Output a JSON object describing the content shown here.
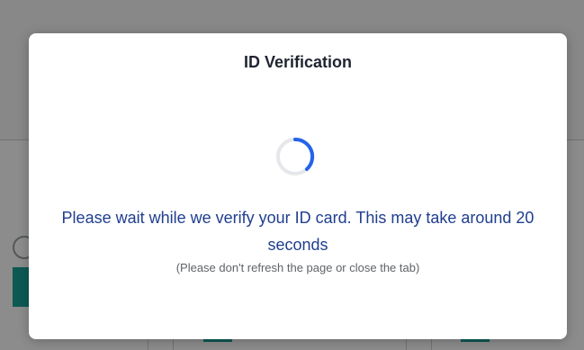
{
  "modal": {
    "title": "ID Verification",
    "message": "Please wait while we verify your ID card. This may take around 20 seconds",
    "hint": "(Please don't refresh the page or close the tab)"
  },
  "icons": {
    "spinner": "loading-spinner-icon"
  },
  "colors": {
    "overlay": "#000000",
    "message_text": "#1f3e8f",
    "spinner_accent": "#2563eb",
    "spinner_track": "#e5e7eb",
    "brand_teal": "#1aa39a"
  }
}
